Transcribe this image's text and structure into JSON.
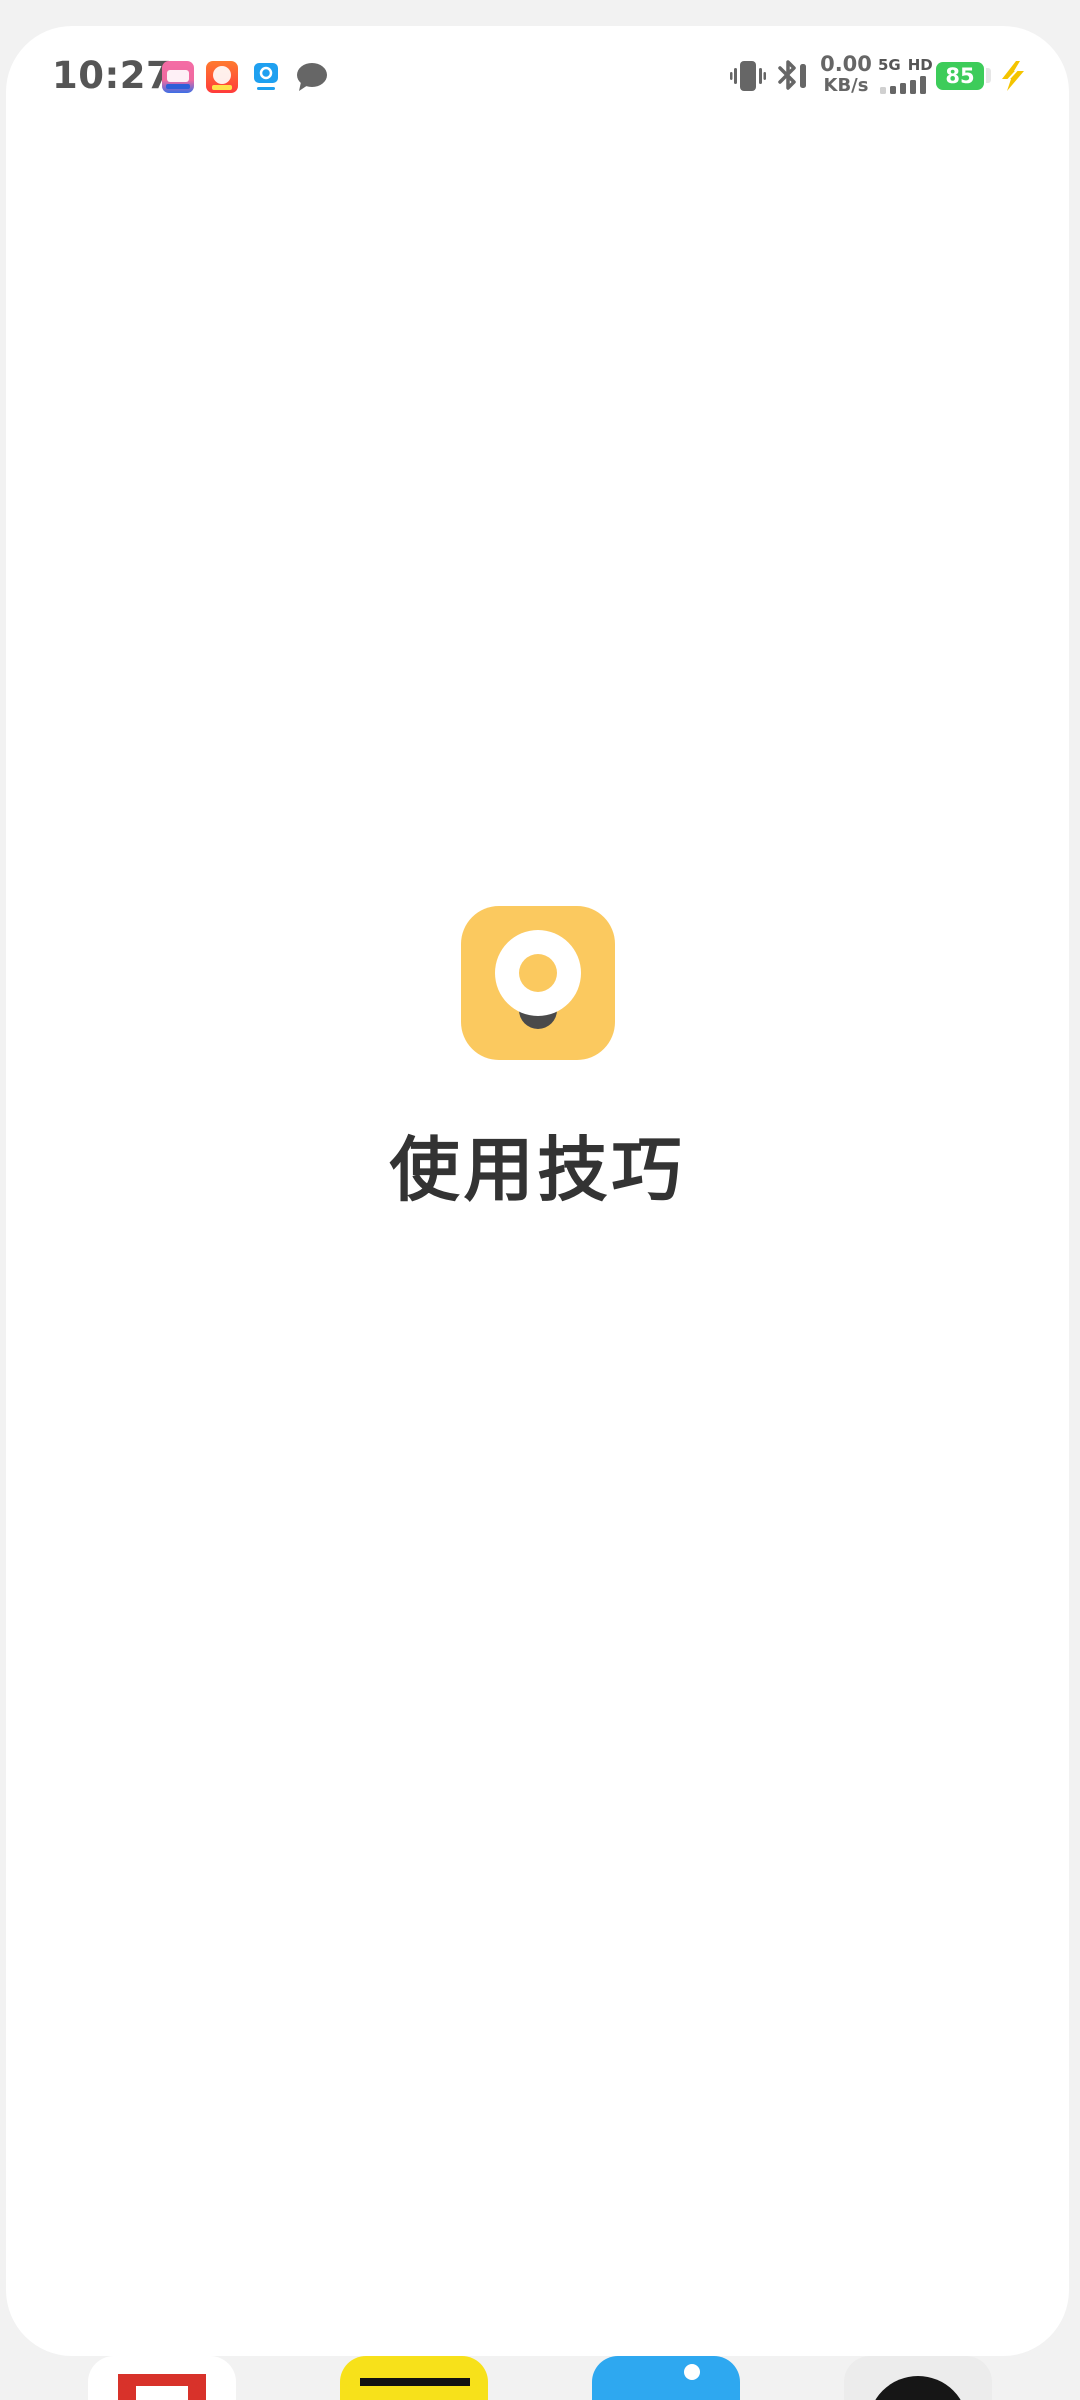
{
  "status_bar": {
    "time": "10:27",
    "notifications": [
      "bilibili-app-icon",
      "taobao-app-icon",
      "eleme-app-icon",
      "message-bubble-icon"
    ],
    "net_speed_value": "0.00",
    "net_speed_unit": "KB/s",
    "network_type": "5G",
    "hd_label": "HD",
    "battery_level": "85",
    "charging": true
  },
  "splash": {
    "app_title": "使用技巧",
    "logo_color": "#fbc95f"
  },
  "colors": {
    "background": "#f2f2f2",
    "card": "#ffffff",
    "battery": "#3dcc5a",
    "charging_bolt": "#f4c400",
    "title_text": "#333333"
  }
}
